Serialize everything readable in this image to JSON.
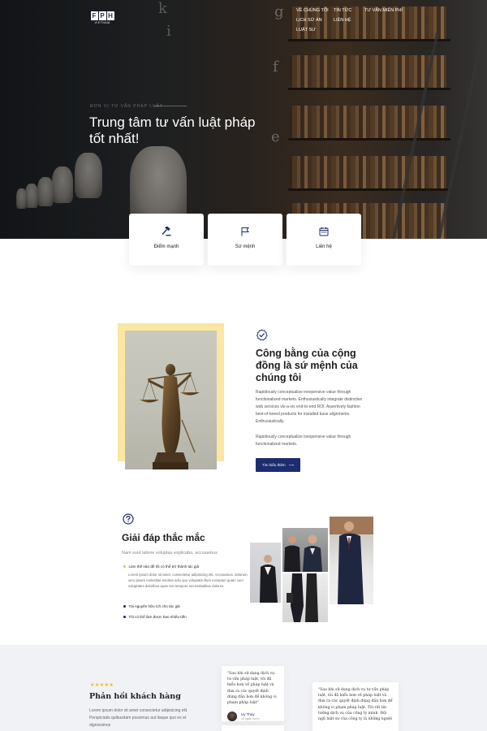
{
  "brand": {
    "logo_letters": [
      "F",
      "P",
      "H"
    ],
    "logo_sub": "VIETNAM"
  },
  "nav": {
    "items": [
      "VỀ CHÚNG TÔI",
      "LỊCH SỬ ÁN",
      "LUẬT SƯ",
      "TIN TỨC",
      "LIÊN HỆ",
      "TƯ VẤN MIỄN PHÍ"
    ]
  },
  "hero": {
    "kicker": "ĐƠN VỊ TƯ VẤN PHÁP LUẬT",
    "title": "Trung tâm tư vấn luật pháp tốt nhất!",
    "letters": [
      "k",
      "i",
      "g",
      "f",
      "e"
    ]
  },
  "features": [
    {
      "icon": "gavel-icon",
      "label": "Điểm mạnh"
    },
    {
      "icon": "flag-icon",
      "label": "Sứ mệnh"
    },
    {
      "icon": "calendar-icon",
      "label": "Liên hệ"
    }
  ],
  "mission": {
    "title": "Công bằng của cộng đồng là sứ mệnh của chúng tôi",
    "paragraph1": "Rapidiously conceptualize inexpensive value through functionalized markets. Enthusiastically integrate distinctive web services vis-a-vis end-to-end ROI. Assertively fashion best-of-breed products for installed base alignments. Enthusiastically.",
    "paragraph2": "Rapidiously conceptualize inexpensive value through functionalized markets.",
    "button_label": "Tìm hiểu thêm",
    "button_arrow": "⟶"
  },
  "faq": {
    "title": "Giải đáp thắc mắc",
    "subtitle": "Nam sunt labore voluptas explicabo, accusamus",
    "items": [
      {
        "q": "Làm thế nào để tôi có thể trở thành tác giả",
        "open": true
      },
      {
        "q": "Tài nguyên hữu ích cho tác giả",
        "open": false
      },
      {
        "q": "Tôi có thể làm được bao nhiêu tiền",
        "open": false
      }
    ],
    "answer": "Lorem ipsum dolor sit amet, consectetur adipisicing elit. Accusamus, dolorum, vero ipsum molestiae minima odio quo voluptate illum excepturi quam cum voluptates doloribus quae nisi tempore necessitatibus dolores."
  },
  "testimonials": {
    "stars": "★★★★★",
    "title": "Phản hồi khách hàng",
    "paragraph": "Lorem ipsum dolor sit amet consectetur adipisicing elit. Perspiciatis quibusdam possimus aut itaque quo ex et dignissimos",
    "quotes": [
      {
        "text": "\"Sau khi sử dụng dịch vụ tư vấn pháp luật, tôi đã hiểu hơn về pháp luật và đưa ra các quyết định đúng đắn hơn để không vi phạm pháp luật\"",
        "name": "Uy Thủy",
        "time": "10 ngày trước"
      },
      {
        "text": "\"Sau khi sử dụng dịch vụ tư vấn pháp luật, tôi đã hiểu hơn về pháp luật và đưa ra các quyết định đúng đắn hơn để không vi phạm pháp luật. Tôi rất tin tưởng dịch vụ của công ty mình. Đội ngũ luật sư của công ty là những người",
        "name": "",
        "time": ""
      }
    ]
  },
  "colors": {
    "primary": "#1e2c6f",
    "accent_yellow": "#fbe7a1",
    "star": "#f1b81c",
    "bullet": "#f1c232"
  }
}
